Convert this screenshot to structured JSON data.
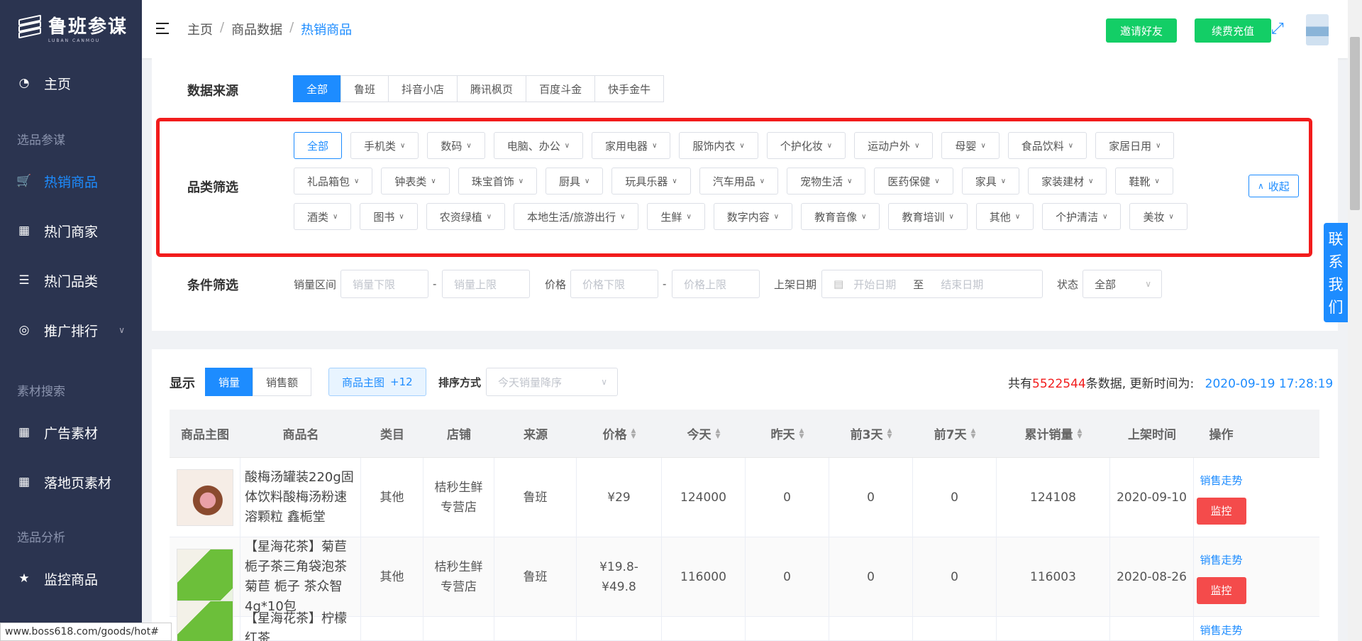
{
  "sidebar": {
    "logo_text": "鲁班参谋",
    "logo_sub": "LUBAN CANMOU",
    "items": [
      {
        "label": "主页",
        "icon": "dashboard-icon"
      },
      {
        "group": "选品参谋"
      },
      {
        "label": "热销商品",
        "icon": "cart-icon",
        "active": true
      },
      {
        "label": "热门商家",
        "icon": "grid-icon"
      },
      {
        "label": "热门品类",
        "icon": "list-icon"
      },
      {
        "label": "推广排行",
        "icon": "chart-icon"
      },
      {
        "group": "素材搜索"
      },
      {
        "label": "广告素材",
        "icon": "grid-icon"
      },
      {
        "label": "落地页素材",
        "icon": "grid-icon"
      },
      {
        "group": "选品分析"
      },
      {
        "label": "监控商品",
        "icon": "star-icon"
      }
    ]
  },
  "header": {
    "breadcrumb": [
      "主页",
      "商品数据",
      "热销商品"
    ],
    "invite": "邀请好友",
    "recharge": "续费充值"
  },
  "filters": {
    "source_label": "数据来源",
    "sources": [
      "全部",
      "鲁班",
      "抖音小店",
      "腾讯枫页",
      "百度斗金",
      "快手金牛"
    ],
    "category_label": "品类筛选",
    "categories": [
      "全部",
      "手机类",
      "数码",
      "电脑、办公",
      "家用电器",
      "服饰内衣",
      "个护化妆",
      "运动户外",
      "母婴",
      "食品饮料",
      "家居日用",
      "礼品箱包",
      "钟表类",
      "珠宝首饰",
      "厨具",
      "玩具乐器",
      "汽车用品",
      "宠物生活",
      "医药保健",
      "家具",
      "家装建材",
      "鞋靴",
      "酒类",
      "图书",
      "农资绿植",
      "本地生活/旅游出行",
      "生鲜",
      "数字内容",
      "教育音像",
      "教育培训",
      "其他",
      "个护清洁",
      "美妆"
    ],
    "collapse": "收起",
    "condition_label": "条件筛选",
    "sales_range": "销量区间",
    "sales_min": "销量下限",
    "sales_max": "销量上限",
    "price": "价格",
    "price_min": "价格下限",
    "price_max": "价格上限",
    "date": "上架日期",
    "date_start": "开始日期",
    "date_to": "至",
    "date_end": "结束日期",
    "status": "状态",
    "status_value": "全部",
    "dash": "-"
  },
  "contact": [
    "联",
    "系",
    "我",
    "们"
  ],
  "table": {
    "display": "显示",
    "tab_sales": "销量",
    "tab_amount": "销售额",
    "main_img": "商品主图",
    "main_img_count": "+12",
    "sort_label": "排序方式",
    "sort_value": "今天销量降序",
    "summary_prefix": "共有",
    "summary_count": "5522544",
    "summary_mid": "条数据, 更新时间为:",
    "updated": "2020-09-19 17:28:19",
    "headers": [
      "商品主图",
      "商品名",
      "类目",
      "店铺",
      "来源",
      "价格",
      "今天",
      "昨天",
      "前3天",
      "前7天",
      "累计销量",
      "上架时间",
      "操作"
    ],
    "rows": [
      {
        "name": "酸梅汤罐装220g固体饮料酸梅汤粉速溶颗粒 鑫栀堂",
        "cat": "其他",
        "shop": "桔秒生鲜专营店",
        "src": "鲁班",
        "price": "¥29",
        "today": "124000",
        "yday": "0",
        "d3": "0",
        "d7": "0",
        "total": "124108",
        "date": "2020-09-10",
        "trend": "销售走势",
        "monitor": "监控"
      },
      {
        "name": "【星海花茶】菊苣栀子茶三角袋泡茶 菊苣 栀子 茶众智 4g*10包",
        "cat": "其他",
        "shop": "桔秒生鲜专营店",
        "src": "鲁班",
        "price": "¥19.8- ¥49.8",
        "today": "116000",
        "yday": "0",
        "d3": "0",
        "d7": "0",
        "total": "116003",
        "date": "2020-08-26",
        "trend": "销售走势",
        "monitor": "监控"
      },
      {
        "name": "【星海花茶】柠檬红茶",
        "trend": "销售走势"
      }
    ]
  },
  "statusbar": "www.boss618.com/goods/hot#"
}
